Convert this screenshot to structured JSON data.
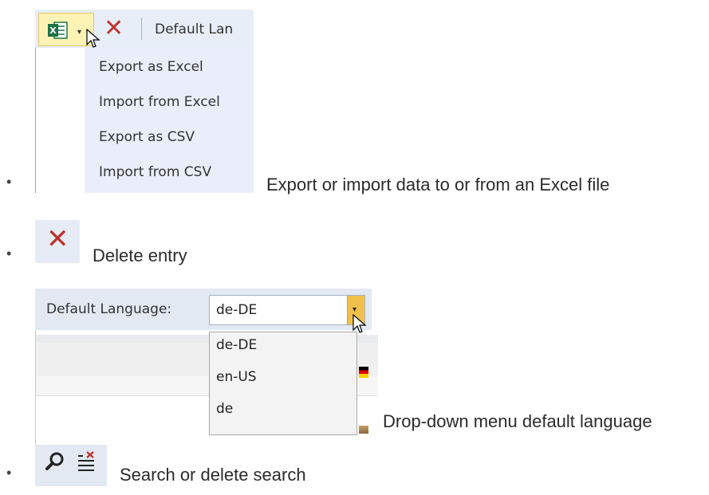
{
  "excel_section": {
    "toolbar": {
      "excel_icon": "excel-icon",
      "dropdown_arrow": "▾",
      "delete_icon": "✕",
      "default_language_truncated": "Default Lan"
    },
    "menu_items": [
      "Export as Excel",
      "Import from Excel",
      "Export as CSV",
      "Import from CSV"
    ],
    "caption": "Export or import data to or from an Excel file"
  },
  "delete_section": {
    "icon": "✕",
    "caption": "Delete entry"
  },
  "language_section": {
    "label": "Default Language:",
    "selected": "de-DE",
    "options": [
      "de-DE",
      "en-US",
      "de"
    ],
    "dropdown_arrow": "▾",
    "caption": "Drop-down menu default language"
  },
  "search_section": {
    "search_icon": "search-icon",
    "clear_search_icon": "clear-search-icon",
    "caption": "Search or delete search"
  },
  "bullet": "•",
  "colors": {
    "toolbar_bg": "#e8eef7",
    "highlight": "#fdf3b4",
    "dropdown_button": "#f2c04a",
    "delete_red": "#c0362c"
  }
}
